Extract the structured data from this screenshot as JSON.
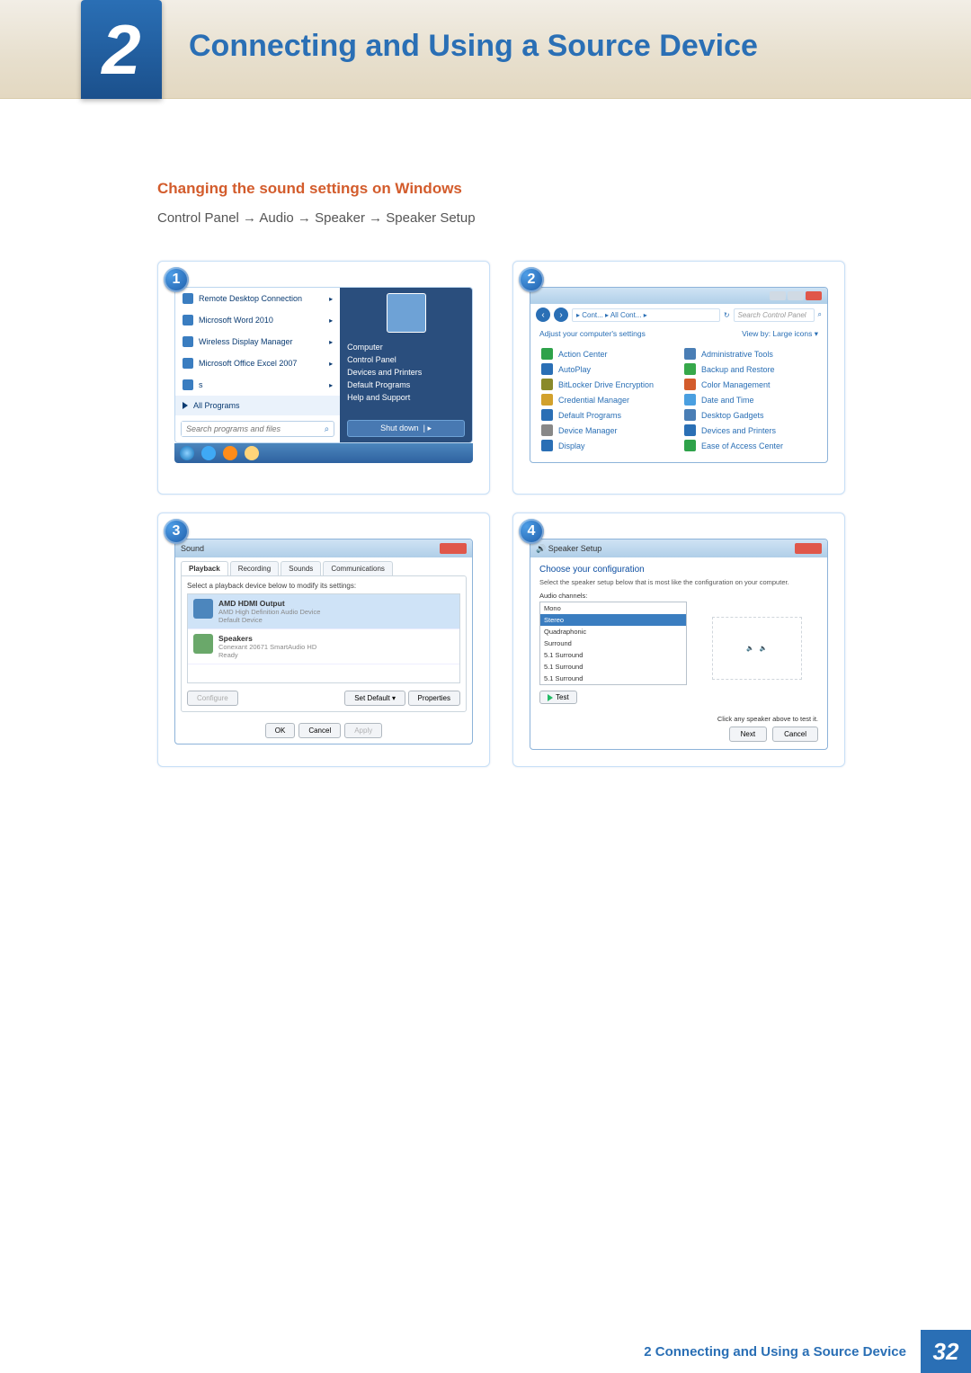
{
  "chapter_number": "2",
  "page_title": "Connecting and Using a Source Device",
  "section_title": "Changing the sound settings on Windows",
  "path": "Control Panel  →  Audio  →  Speaker  →  Speaker Setup",
  "panels": [
    "1",
    "2",
    "3",
    "4"
  ],
  "start_menu": {
    "items": [
      "Remote Desktop Connection",
      "Microsoft Word 2010",
      "Wireless Display Manager",
      "Microsoft Office Excel 2007",
      "s"
    ],
    "all_programs": "All Programs",
    "search_placeholder": "Search programs and files",
    "right": [
      "Computer",
      "Control Panel",
      "Devices and Printers",
      "Default Programs",
      "Help and Support"
    ],
    "shutdown": "Shut down"
  },
  "control_panel": {
    "breadcrumb": "▸ Cont... ▸ All Cont... ▸",
    "search_placeholder": "Search Control Panel",
    "adjust": "Adjust your computer's settings",
    "viewby": "View by:  Large icons ▾",
    "items": [
      {
        "l": "Action Center",
        "c": "#2ea24a"
      },
      {
        "l": "Administrative Tools",
        "c": "#4a7eb5"
      },
      {
        "l": "AutoPlay",
        "c": "#2a6fb5"
      },
      {
        "l": "Backup and Restore",
        "c": "#36a84a"
      },
      {
        "l": "BitLocker Drive Encryption",
        "c": "#8a8a2a"
      },
      {
        "l": "Color Management",
        "c": "#d35c2c"
      },
      {
        "l": "Credential Manager",
        "c": "#d2a12c"
      },
      {
        "l": "Date and Time",
        "c": "#4a9fe0"
      },
      {
        "l": "Default Programs",
        "c": "#2a6fb5"
      },
      {
        "l": "Desktop Gadgets",
        "c": "#4a7eb5"
      },
      {
        "l": "Device Manager",
        "c": "#888"
      },
      {
        "l": "Devices and Printers",
        "c": "#2a6fb5"
      },
      {
        "l": "Display",
        "c": "#2a6fb5"
      },
      {
        "l": "Ease of Access Center",
        "c": "#2ea24a"
      }
    ]
  },
  "sound": {
    "title": "Sound",
    "tabs": [
      "Playback",
      "Recording",
      "Sounds",
      "Communications"
    ],
    "hint": "Select a playback device below to modify its settings:",
    "dev1": {
      "name": "AMD HDMI Output",
      "line2": "AMD High Definition Audio Device",
      "line3": "Default Device"
    },
    "dev2": {
      "name": "Speakers",
      "line2": "Conexant 20671 SmartAudio HD",
      "line3": "Ready"
    },
    "configure": "Configure",
    "set_default": "Set Default  ▾",
    "properties": "Properties",
    "ok": "OK",
    "cancel": "Cancel",
    "apply": "Apply"
  },
  "speaker": {
    "title": "Speaker Setup",
    "heading": "Choose your configuration",
    "sub": "Select the speaker setup below that is most like the configuration on your computer.",
    "ch_label": "Audio channels:",
    "channels": [
      "Mono",
      "Stereo",
      "Quadraphonic",
      "Surround",
      "5.1 Surround",
      "5.1 Surround",
      "5.1 Surround"
    ],
    "selected_index": 1,
    "test": "Test",
    "hint": "Click any speaker above to test it.",
    "next": "Next",
    "cancel": "Cancel"
  },
  "footer": {
    "text": "2 Connecting and Using a Source Device",
    "page": "32"
  }
}
